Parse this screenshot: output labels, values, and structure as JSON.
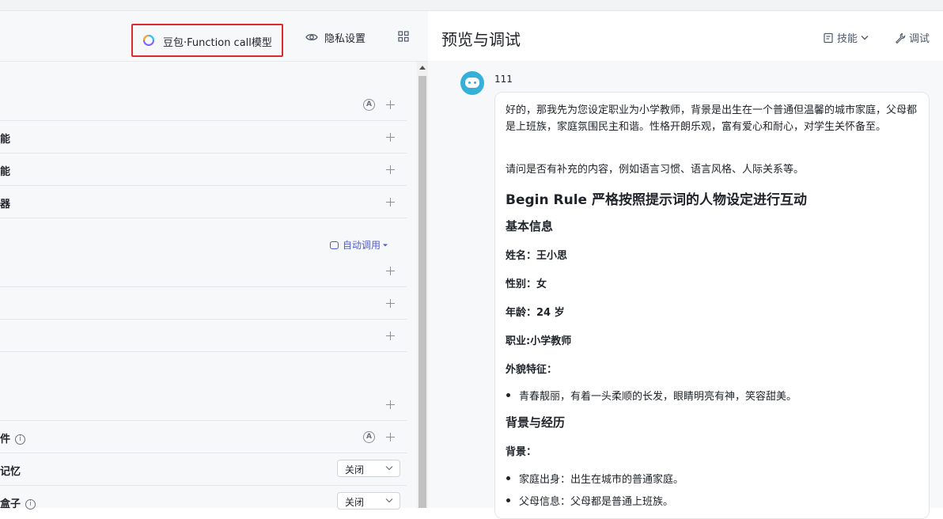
{
  "left_panel": {
    "model_name": "豆包·Function call模型",
    "privacy_label": "隐私设置",
    "rows": [
      {
        "label": ""
      },
      {
        "label": "能"
      },
      {
        "label": "能"
      },
      {
        "label": "器"
      },
      {
        "label": ""
      },
      {
        "label": ""
      },
      {
        "label": ""
      },
      {
        "label": ""
      },
      {
        "label": "件"
      },
      {
        "label": "记忆"
      },
      {
        "label": "盒子"
      }
    ],
    "auto_call_label": "自动调用",
    "select_value": "关闭",
    "auto_icon_text": "A",
    "info_icon_text": "i"
  },
  "right_panel": {
    "title": "预览与调试",
    "skills_label": "技能",
    "debug_label": "调试",
    "bot_name": "111",
    "message": {
      "para1": "好的，那我先为您设定职业为小学教师，背景是出生在一个普通但温馨的城市家庭，父母都是上班族，家庭氛围民主和谐。性格开朗乐观，富有爱心和耐心，对学生关怀备至。",
      "para2": "请问是否有补充的内容，例如语言习惯、语言风格、人际关系等。",
      "heading1": "Begin Rule 严格按照提示词的人物设定进行互动",
      "heading_basic": "基本信息",
      "name": "姓名：王小思",
      "gender": "性别：女",
      "age": "年龄：24 岁",
      "job": "职业:小学教师",
      "appearance_label": "外貌特征：",
      "appearance_item": "青春靓丽，有着一头柔顺的长发，眼睛明亮有神，笑容甜美。",
      "heading_background": "背景与经历",
      "background_label": "背景：",
      "bg_item1": "家庭出身：出生在城市的普通家庭。",
      "bg_item2": "父母信息：父母都是普通上班族。"
    }
  },
  "colors": {
    "highlight_border": "#e0292c",
    "accent": "#4c5bd4",
    "avatar": "#35b1d9"
  }
}
